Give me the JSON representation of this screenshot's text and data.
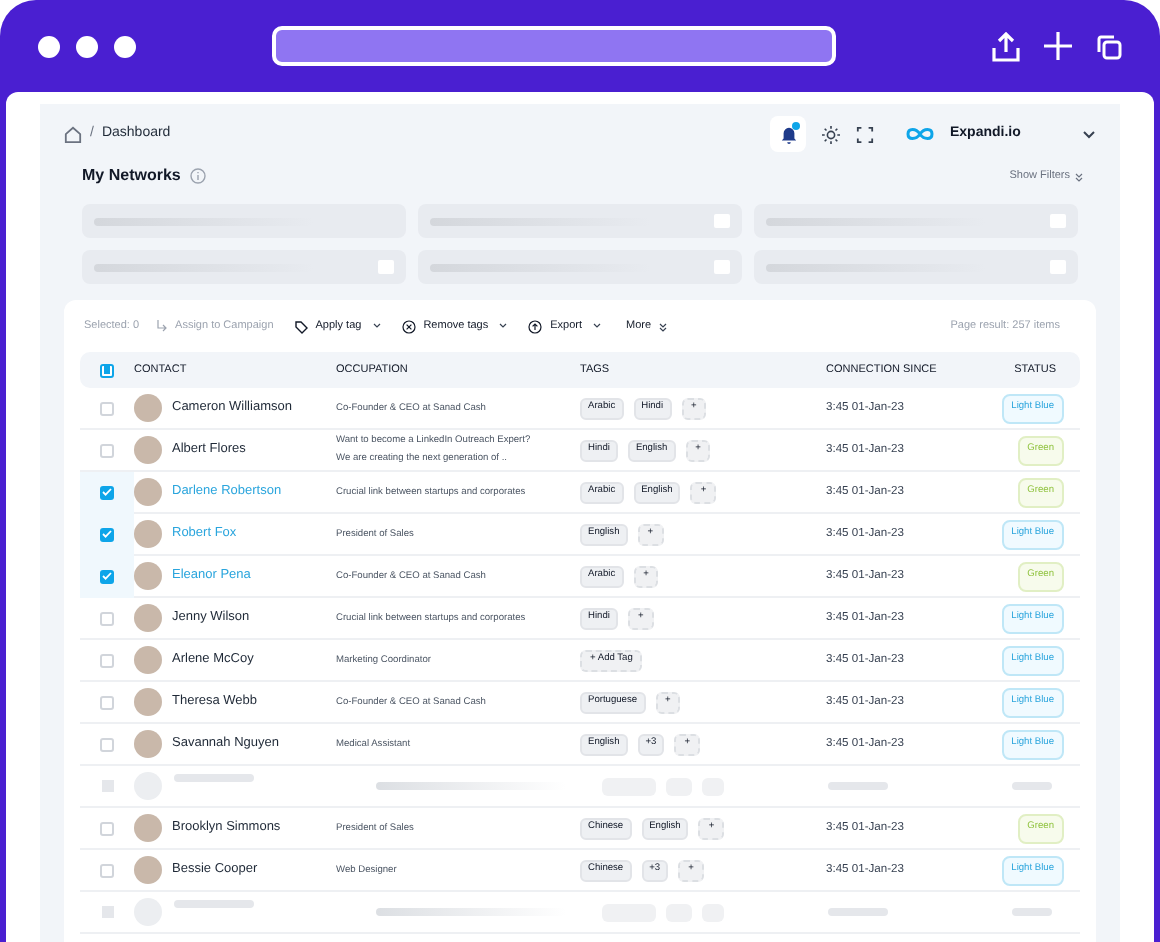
{
  "breadcrumb": {
    "current": "Dashboard",
    "separator": "/"
  },
  "brand": {
    "name": "Expandi.io"
  },
  "notifications": {
    "unread": true
  },
  "page": {
    "title": "My Networks",
    "show_filters": "Show Filters"
  },
  "toolbar": {
    "selected": "Selected: 0",
    "assign": "Assign to Campaign",
    "apply_tag": "Apply tag",
    "remove_tags": "Remove tags",
    "export": "Export",
    "more": "More",
    "page_result": "Page result: 257 items"
  },
  "table": {
    "select_all_partial": true,
    "columns": [
      "CONTACT",
      "OCCUPATION",
      "TAGS",
      "CONNECTION SINCE",
      "STATUS"
    ],
    "rows": [
      {
        "kind": "contact",
        "selected": false,
        "name": "Cameron Williamson",
        "occupation": [
          "Co-Founder & CEO at Sanad Cash"
        ],
        "tags": [
          {
            "label": "Arabic",
            "kind": "tag"
          },
          {
            "label": "Hindi",
            "kind": "tag"
          },
          {
            "label": "+",
            "kind": "add"
          }
        ],
        "since": "3:45 01-Jan-23",
        "status": {
          "label": "Light Blue",
          "kind": "blue"
        }
      },
      {
        "kind": "contact",
        "selected": false,
        "name": "Albert Flores",
        "occupation": [
          "Want to become a LinkedIn Outreach Expert?",
          "We are creating the next generation of .."
        ],
        "tags": [
          {
            "label": "Hindi",
            "kind": "tag"
          },
          {
            "label": "English",
            "kind": "tag"
          },
          {
            "label": "+",
            "kind": "add"
          }
        ],
        "since": "3:45 01-Jan-23",
        "status": {
          "label": "Green",
          "kind": "green"
        }
      },
      {
        "kind": "contact",
        "selected": true,
        "name": "Darlene Robertson",
        "occupation": [
          "Crucial link between startups and corporates"
        ],
        "tags": [
          {
            "label": "Arabic",
            "kind": "tag"
          },
          {
            "label": "English",
            "kind": "tag"
          },
          {
            "label": "+",
            "kind": "add"
          }
        ],
        "since": "3:45 01-Jan-23",
        "status": {
          "label": "Green",
          "kind": "green"
        }
      },
      {
        "kind": "contact",
        "selected": true,
        "name": "Robert Fox",
        "occupation": [
          "President of Sales"
        ],
        "tags": [
          {
            "label": "English",
            "kind": "tag"
          },
          {
            "label": "+",
            "kind": "add"
          }
        ],
        "since": "3:45 01-Jan-23",
        "status": {
          "label": "Light Blue",
          "kind": "blue"
        }
      },
      {
        "kind": "contact",
        "selected": true,
        "name": "Eleanor Pena",
        "occupation": [
          "Co-Founder & CEO at Sanad Cash"
        ],
        "tags": [
          {
            "label": "Arabic",
            "kind": "tag"
          },
          {
            "label": "+",
            "kind": "add"
          }
        ],
        "since": "3:45 01-Jan-23",
        "status": {
          "label": "Green",
          "kind": "green"
        }
      },
      {
        "kind": "contact",
        "selected": false,
        "name": "Jenny Wilson",
        "occupation": [
          "Crucial link between startups and corporates"
        ],
        "tags": [
          {
            "label": "Hindi",
            "kind": "tag"
          },
          {
            "label": "+",
            "kind": "add"
          }
        ],
        "since": "3:45 01-Jan-23",
        "status": {
          "label": "Light Blue",
          "kind": "blue"
        }
      },
      {
        "kind": "contact",
        "selected": false,
        "name": "Arlene McCoy",
        "occupation": [
          "Marketing Coordinator"
        ],
        "tags": [
          {
            "label": "+ Add Tag",
            "kind": "add"
          }
        ],
        "since": "3:45 01-Jan-23",
        "status": {
          "label": "Light Blue",
          "kind": "blue"
        }
      },
      {
        "kind": "contact",
        "selected": false,
        "name": "Theresa Webb",
        "occupation": [
          "Co-Founder & CEO at Sanad Cash"
        ],
        "tags": [
          {
            "label": "Portuguese",
            "kind": "tag"
          },
          {
            "label": "+",
            "kind": "add"
          }
        ],
        "since": "3:45 01-Jan-23",
        "status": {
          "label": "Light Blue",
          "kind": "blue"
        }
      },
      {
        "kind": "contact",
        "selected": false,
        "name": "Savannah Nguyen",
        "occupation": [
          "Medical Assistant"
        ],
        "tags": [
          {
            "label": "English",
            "kind": "tag"
          },
          {
            "label": "+3",
            "kind": "tag"
          },
          {
            "label": "+",
            "kind": "add"
          }
        ],
        "since": "3:45 01-Jan-23",
        "status": {
          "label": "Light Blue",
          "kind": "blue"
        }
      },
      {
        "kind": "loading"
      },
      {
        "kind": "contact",
        "selected": false,
        "name": "Brooklyn Simmons",
        "occupation": [
          "President of Sales"
        ],
        "tags": [
          {
            "label": "Chinese",
            "kind": "tag"
          },
          {
            "label": "English",
            "kind": "tag"
          },
          {
            "label": "+",
            "kind": "add"
          }
        ],
        "since": "3:45 01-Jan-23",
        "status": {
          "label": "Green",
          "kind": "green"
        }
      },
      {
        "kind": "contact",
        "selected": false,
        "name": "Bessie Cooper",
        "occupation": [
          "Web Designer"
        ],
        "tags": [
          {
            "label": "Chinese",
            "kind": "tag"
          },
          {
            "label": "+3",
            "kind": "tag"
          },
          {
            "label": "+",
            "kind": "add"
          }
        ],
        "since": "3:45 01-Jan-23",
        "status": {
          "label": "Light Blue",
          "kind": "blue"
        }
      },
      {
        "kind": "loading"
      }
    ]
  }
}
